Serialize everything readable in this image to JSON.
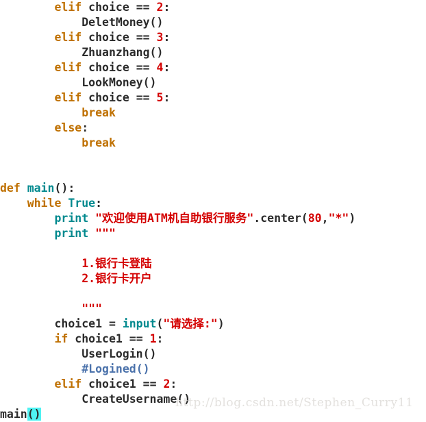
{
  "editor": {
    "language": "python",
    "background_color": "#ffffff",
    "colors": {
      "keyword": "#bf7000",
      "builtin": "#00898e",
      "number": "#d40000",
      "string": "#d40000",
      "plain": "#2b2b2b",
      "comment": "#4b72ab",
      "bracket_highlight_bg": "#4ff2f2",
      "watermark": "#e3e1de"
    }
  },
  "watermark": {
    "text": "http://blog.csdn.net/Stephen_Curry11"
  },
  "lines": [
    {
      "id": "line-1",
      "tokens": [
        {
          "t": "plain",
          "v": "        "
        },
        {
          "t": "keyword",
          "v": "elif"
        },
        {
          "t": "plain",
          "v": " choice == "
        },
        {
          "t": "number",
          "v": "2"
        },
        {
          "t": "plain",
          "v": ":"
        }
      ]
    },
    {
      "id": "line-2",
      "tokens": [
        {
          "t": "plain",
          "v": "            DeletMoney()"
        }
      ]
    },
    {
      "id": "line-3",
      "tokens": [
        {
          "t": "plain",
          "v": "        "
        },
        {
          "t": "keyword",
          "v": "elif"
        },
        {
          "t": "plain",
          "v": " choice == "
        },
        {
          "t": "number",
          "v": "3"
        },
        {
          "t": "plain",
          "v": ":"
        }
      ]
    },
    {
      "id": "line-4",
      "tokens": [
        {
          "t": "plain",
          "v": "            Zhuanzhang()"
        }
      ]
    },
    {
      "id": "line-5",
      "tokens": [
        {
          "t": "plain",
          "v": "        "
        },
        {
          "t": "keyword",
          "v": "elif"
        },
        {
          "t": "plain",
          "v": " choice == "
        },
        {
          "t": "number",
          "v": "4"
        },
        {
          "t": "plain",
          "v": ":"
        }
      ]
    },
    {
      "id": "line-6",
      "tokens": [
        {
          "t": "plain",
          "v": "            LookMoney()"
        }
      ]
    },
    {
      "id": "line-7",
      "tokens": [
        {
          "t": "plain",
          "v": "        "
        },
        {
          "t": "keyword",
          "v": "elif"
        },
        {
          "t": "plain",
          "v": " choice == "
        },
        {
          "t": "number",
          "v": "5"
        },
        {
          "t": "plain",
          "v": ":"
        }
      ]
    },
    {
      "id": "line-8",
      "tokens": [
        {
          "t": "plain",
          "v": "            "
        },
        {
          "t": "keyword",
          "v": "break"
        }
      ]
    },
    {
      "id": "line-9",
      "tokens": [
        {
          "t": "plain",
          "v": "        "
        },
        {
          "t": "keyword",
          "v": "else"
        },
        {
          "t": "plain",
          "v": ":"
        }
      ]
    },
    {
      "id": "line-10",
      "tokens": [
        {
          "t": "plain",
          "v": "            "
        },
        {
          "t": "keyword",
          "v": "break"
        }
      ]
    },
    {
      "id": "line-11",
      "tokens": []
    },
    {
      "id": "line-12",
      "tokens": []
    },
    {
      "id": "line-13",
      "tokens": [
        {
          "t": "keyword",
          "v": "def"
        },
        {
          "t": "plain",
          "v": " "
        },
        {
          "t": "builtin",
          "v": "main"
        },
        {
          "t": "plain",
          "v": "():"
        }
      ]
    },
    {
      "id": "line-14",
      "tokens": [
        {
          "t": "plain",
          "v": "    "
        },
        {
          "t": "keyword",
          "v": "while"
        },
        {
          "t": "plain",
          "v": " "
        },
        {
          "t": "builtin",
          "v": "True"
        },
        {
          "t": "plain",
          "v": ":"
        }
      ]
    },
    {
      "id": "line-15",
      "tokens": [
        {
          "t": "plain",
          "v": "        "
        },
        {
          "t": "builtin",
          "v": "print"
        },
        {
          "t": "plain",
          "v": " "
        },
        {
          "t": "string",
          "v": "\"欢迎使用ATM机自助银行服务\""
        },
        {
          "t": "plain",
          "v": ".center("
        },
        {
          "t": "number",
          "v": "80"
        },
        {
          "t": "plain",
          "v": ","
        },
        {
          "t": "string",
          "v": "\"*\""
        },
        {
          "t": "plain",
          "v": ")"
        }
      ]
    },
    {
      "id": "line-16",
      "tokens": [
        {
          "t": "plain",
          "v": "        "
        },
        {
          "t": "builtin",
          "v": "print"
        },
        {
          "t": "plain",
          "v": " "
        },
        {
          "t": "string",
          "v": "\"\"\""
        }
      ]
    },
    {
      "id": "line-17",
      "tokens": []
    },
    {
      "id": "line-18",
      "tokens": [
        {
          "t": "string",
          "v": "            1.银行卡登陆"
        }
      ]
    },
    {
      "id": "line-19",
      "tokens": [
        {
          "t": "string",
          "v": "            2.银行卡开户"
        }
      ]
    },
    {
      "id": "line-20",
      "tokens": []
    },
    {
      "id": "line-21",
      "tokens": [
        {
          "t": "string",
          "v": "            \"\"\""
        }
      ]
    },
    {
      "id": "line-22",
      "tokens": [
        {
          "t": "plain",
          "v": "        choice1 = "
        },
        {
          "t": "builtin",
          "v": "input"
        },
        {
          "t": "plain",
          "v": "("
        },
        {
          "t": "string",
          "v": "\"请选择:\""
        },
        {
          "t": "plain",
          "v": ")"
        }
      ]
    },
    {
      "id": "line-23",
      "tokens": [
        {
          "t": "plain",
          "v": "        "
        },
        {
          "t": "keyword",
          "v": "if"
        },
        {
          "t": "plain",
          "v": " choice1 == "
        },
        {
          "t": "number",
          "v": "1"
        },
        {
          "t": "plain",
          "v": ":"
        }
      ]
    },
    {
      "id": "line-24",
      "tokens": [
        {
          "t": "plain",
          "v": "            UserLogin()"
        }
      ]
    },
    {
      "id": "line-25",
      "tokens": [
        {
          "t": "plain",
          "v": "            "
        },
        {
          "t": "comment",
          "v": "#Logined()"
        }
      ]
    },
    {
      "id": "line-26",
      "tokens": [
        {
          "t": "plain",
          "v": "        "
        },
        {
          "t": "keyword",
          "v": "elif"
        },
        {
          "t": "plain",
          "v": " choice1 == "
        },
        {
          "t": "number",
          "v": "2"
        },
        {
          "t": "plain",
          "v": ":"
        }
      ]
    },
    {
      "id": "line-27",
      "tokens": [
        {
          "t": "plain",
          "v": "            CreateUsername()"
        }
      ]
    },
    {
      "id": "line-28",
      "tokens": [
        {
          "t": "plain",
          "v": "main"
        },
        {
          "t": "highlight",
          "v": "()"
        }
      ]
    }
  ]
}
